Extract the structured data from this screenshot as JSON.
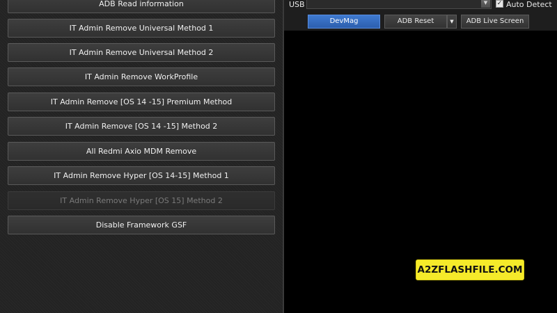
{
  "methods": [
    {
      "label": "ADB Read information",
      "enabled": true
    },
    {
      "label": "IT Admin Remove Universal Method 1",
      "enabled": true
    },
    {
      "label": "IT Admin Remove Universal Method 2",
      "enabled": true
    },
    {
      "label": "IT Admin Remove WorkProfile",
      "enabled": true
    },
    {
      "label": "IT Admin Remove [OS 14 -15] Premium Method",
      "enabled": true
    },
    {
      "label": "IT Admin Remove [OS 14 -15] Method 2",
      "enabled": true
    },
    {
      "label": "All Redmi Axio MDM Remove",
      "enabled": true
    },
    {
      "label": "IT Admin Remove Hyper [OS 14-15] Method 1",
      "enabled": true
    },
    {
      "label": "IT Admin Remove Hyper [OS 15] Method 2",
      "enabled": false
    },
    {
      "label": "Disable Framework GSF",
      "enabled": true
    }
  ],
  "connection": {
    "usb_label": "USB",
    "port_value": "",
    "auto_detect_label": "Auto Detect",
    "auto_detect_checked": true,
    "check_glyph": "✓",
    "arrow_glyph": "▼"
  },
  "toolbar": {
    "devmag_label": "DevMag",
    "adb_reset_label": "ADB Reset",
    "adb_live_screen_label": "ADB Live Screen",
    "caret_glyph": "▼"
  },
  "log": {
    "text": ""
  },
  "watermark": {
    "text": "A2ZFLASHFILE.COM"
  },
  "colors": {
    "primary": "#2c5fae",
    "watermark_bg": "#f5ea2a",
    "log_bg": "#000000"
  }
}
